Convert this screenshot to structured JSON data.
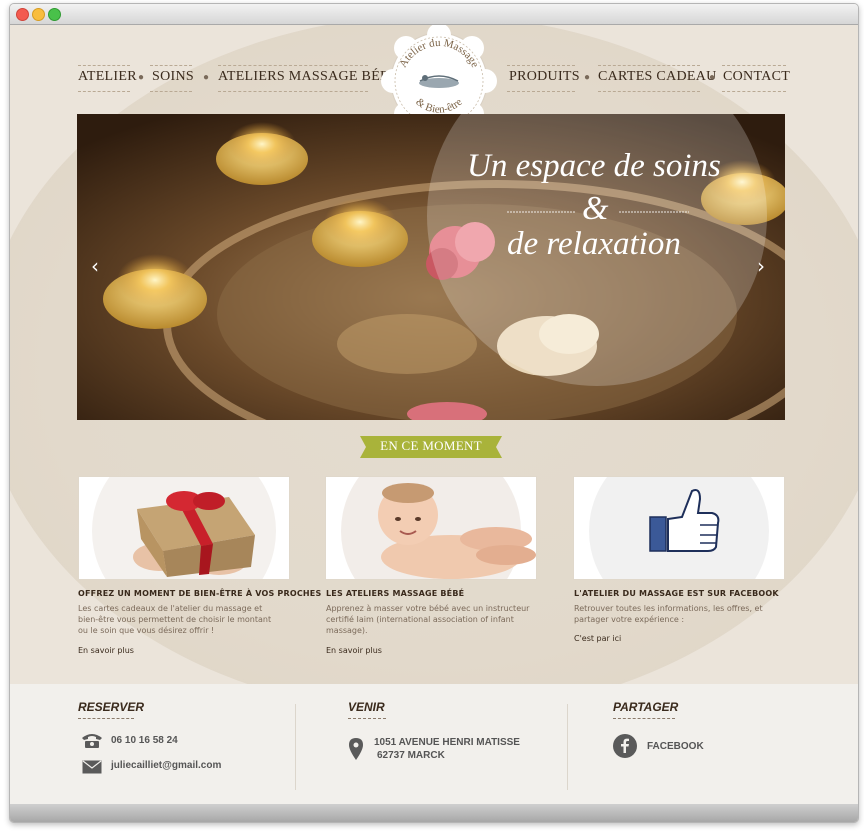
{
  "window": {
    "controls": [
      "close",
      "minimize",
      "zoom"
    ]
  },
  "nav": {
    "left": [
      "ATELIER",
      "SOINS",
      "ATELIERS MASSAGE BÉBÉ"
    ],
    "right": [
      "PRODUITS",
      "CARTES CADEAU",
      "CONTACT"
    ]
  },
  "logo": {
    "line1": "Atelier du Massage",
    "line2": "& Bien-être"
  },
  "hero": {
    "line1": "Un espace de soins",
    "line2": "&",
    "line3": "de relaxation",
    "prev": "‹",
    "next": "›"
  },
  "section": {
    "label": "EN CE MOMENT"
  },
  "cards": [
    {
      "title": "OFFREZ UN MOMENT DE BIEN-ÊTRE À VOS PROCHES",
      "text": [
        "Les cartes cadeaux de l'atelier du massage et",
        "bien-être vous permettent de choisir le montant",
        "ou le soin que vous désirez offrir !"
      ],
      "link": "En savoir plus"
    },
    {
      "title": "LES ATELIERS MASSAGE BÉBÉ",
      "text": [
        "Apprenez à masser votre bébé avec un instructeur",
        "certifié Iaim  (international association of infant",
        "massage)."
      ],
      "link": "En savoir plus"
    },
    {
      "title": "L'ATELIER DU MASSAGE EST SUR FACEBOOK",
      "text": [
        "Retrouver toutes les informations, les offres, et",
        "partager votre expérience :"
      ],
      "link": "C'est par ici"
    }
  ],
  "footer": {
    "reserver": {
      "title": "RESERVER",
      "phone": "06 10 16 58 24",
      "email": "juliecailliet@gmail.com"
    },
    "venir": {
      "title": "VENIR",
      "address1": "1051 AVENUE HENRI MATISSE",
      "address2": "62737 MARCK"
    },
    "partager": {
      "title": "PARTAGER",
      "facebook": "FACEBOOK"
    }
  },
  "colors": {
    "accent_green": "#a9b33a",
    "text_brown": "#3a2a1c",
    "muted_brown": "#7b6a5a"
  }
}
